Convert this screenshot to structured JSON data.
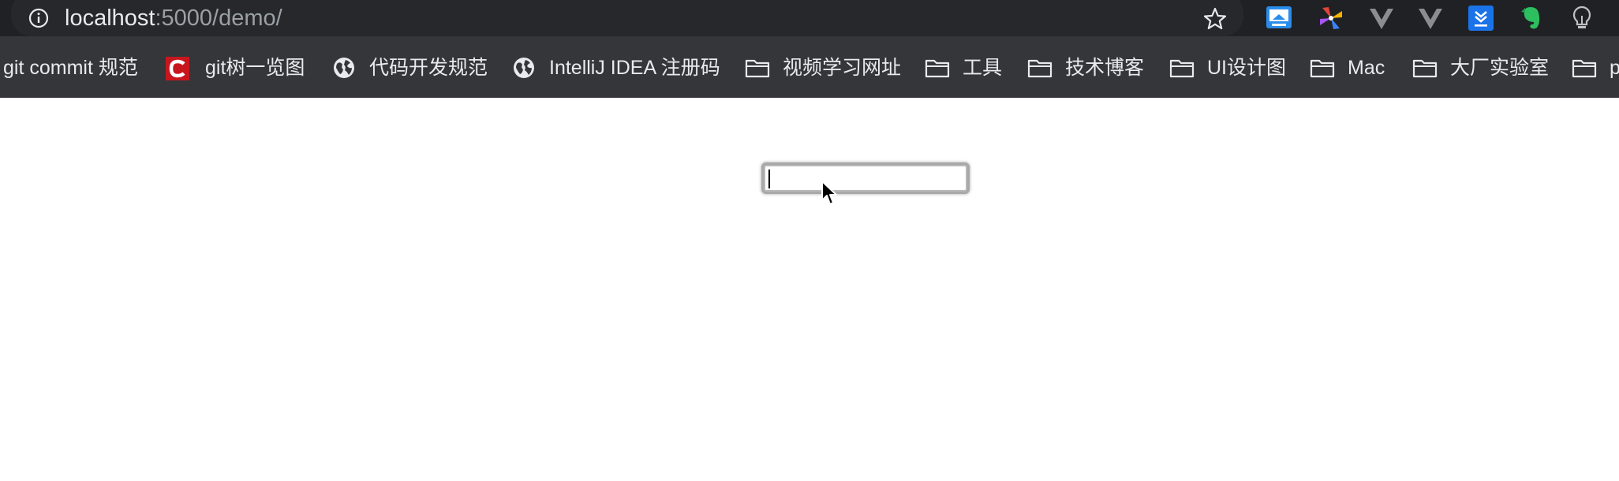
{
  "browser": {
    "url_host": "localhost",
    "url_rest": ":5000/demo/",
    "extensions": [
      "screen-capture-icon",
      "pinwheel-icon",
      "vue-devtools-icon",
      "vue-devtools-alt-icon",
      "download-manager-icon",
      "evernote-icon",
      "lightbulb-icon"
    ]
  },
  "bookmarks": {
    "items": [
      {
        "label": "git commit 规范",
        "icon": "none"
      },
      {
        "label": "git树一览图",
        "icon": "red-c-logo-icon"
      },
      {
        "label": "代码开发规范",
        "icon": "globe-icon"
      },
      {
        "label": "IntelliJ IDEA 注册码",
        "icon": "globe-icon"
      },
      {
        "label": "视频学习网址",
        "icon": "folder-icon"
      },
      {
        "label": "工具",
        "icon": "folder-icon"
      },
      {
        "label": "技术博客",
        "icon": "folder-icon"
      },
      {
        "label": "UI设计图",
        "icon": "folder-icon"
      },
      {
        "label": "Mac",
        "icon": "folder-icon"
      },
      {
        "label": "大厂实验室",
        "icon": "folder-icon"
      },
      {
        "label": "p",
        "icon": "folder-icon"
      }
    ]
  },
  "page": {
    "input_value": ""
  },
  "colors": {
    "chrome_dark": "#202124",
    "bookmark_bar": "#35363a",
    "text_light": "#e8eaed",
    "text_dim": "#9aa0a6"
  }
}
